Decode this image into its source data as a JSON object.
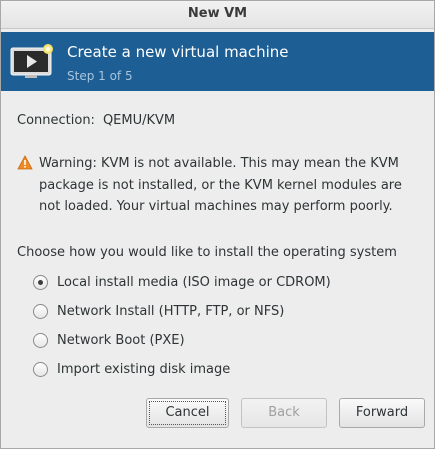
{
  "window": {
    "title": "New VM"
  },
  "banner": {
    "title": "Create a new virtual machine",
    "step": "Step 1 of 5",
    "icon": "vm-monitor-icon",
    "background_color": "#1d5f94"
  },
  "connection": {
    "label": "Connection:",
    "value": "QEMU/KVM"
  },
  "warning": {
    "icon": "warning-icon",
    "text": "Warning: KVM is not available. This may mean the KVM package is not installed, or the KVM kernel modules are not loaded. Your virtual machines may perform poorly."
  },
  "install": {
    "prompt": "Choose how you would like to install the operating system",
    "options": [
      {
        "label": "Local install media (ISO image or CDROM)",
        "selected": true
      },
      {
        "label": "Network Install (HTTP, FTP, or NFS)",
        "selected": false
      },
      {
        "label": "Network Boot (PXE)",
        "selected": false
      },
      {
        "label": "Import existing disk image",
        "selected": false
      }
    ]
  },
  "buttons": {
    "cancel": "Cancel",
    "back": "Back",
    "forward": "Forward"
  }
}
